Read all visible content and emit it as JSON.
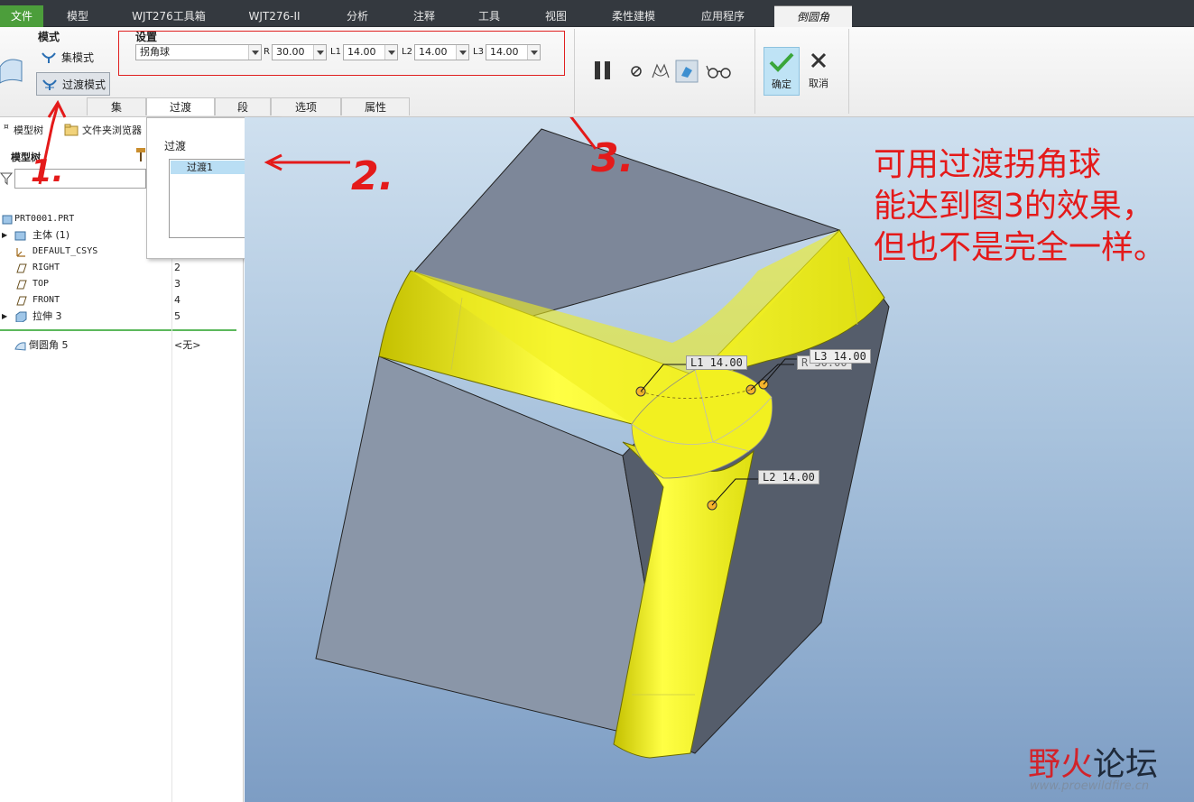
{
  "tabs": [
    {
      "label": "文件",
      "left": 0
    },
    {
      "label": "模型"
    },
    {
      "label": "WJT276工具箱"
    },
    {
      "label": "WJT276-II"
    },
    {
      "label": "分析"
    },
    {
      "label": "注释"
    },
    {
      "label": "工具"
    },
    {
      "label": "视图"
    },
    {
      "label": "柔性建模"
    },
    {
      "label": "应用程序"
    },
    {
      "label": "倒圆角"
    }
  ],
  "ribbon": {
    "mode_title": "模式",
    "set_mode": "集模式",
    "transition_mode": "过渡模式",
    "settings_title": "设置",
    "type_value": "拐角球",
    "r_label": "R",
    "r_value": "30.00",
    "l1_label": "L1",
    "l1_value": "14.00",
    "l2_label": "L2",
    "l2_value": "14.00",
    "l3_label": "L3",
    "l3_value": "14.00",
    "ok_label": "确定",
    "cancel_label": "取消",
    "subtabs": [
      "集",
      "过渡",
      "段",
      "选项",
      "属性"
    ]
  },
  "left_panel": {
    "tab_model_tree": "模型树",
    "tab_folder_browser": "文件夹浏览器",
    "header": "模型树",
    "rows": [
      {
        "name": "PRT0001.PRT",
        "num": ""
      },
      {
        "name": "主体 (1)",
        "num": ""
      },
      {
        "name": "DEFAULT_CSYS",
        "num": ""
      },
      {
        "name": "RIGHT",
        "num": "2"
      },
      {
        "name": "TOP",
        "num": "3"
      },
      {
        "name": "FRONT",
        "num": "4"
      },
      {
        "name": "拉伸 3",
        "num": "5"
      },
      {
        "name": "倒圆角 5",
        "num": "<无>"
      }
    ]
  },
  "popup": {
    "title": "过渡",
    "item": "过渡1"
  },
  "viewport": {
    "dim_l1": "L1 14.00",
    "dim_r": "R 30.00",
    "dim_l3": "L3 14.00",
    "dim_l2": "L2 14.00",
    "note_lines": [
      "可用过渡拐角球",
      "能达到图3的效果，",
      "但也不是完全一样。"
    ],
    "watermark_main_1": "野",
    "watermark_main_2": "火",
    "watermark_main_3": "论坛",
    "watermark_url": "www.proewildfire.cn",
    "annotations": [
      "1.",
      "2.",
      "3."
    ]
  },
  "colors": {
    "fillet_yellow": "#f4f21a",
    "annotation_red": "#e41a1a",
    "file_tab_green": "#4c9e3b"
  }
}
